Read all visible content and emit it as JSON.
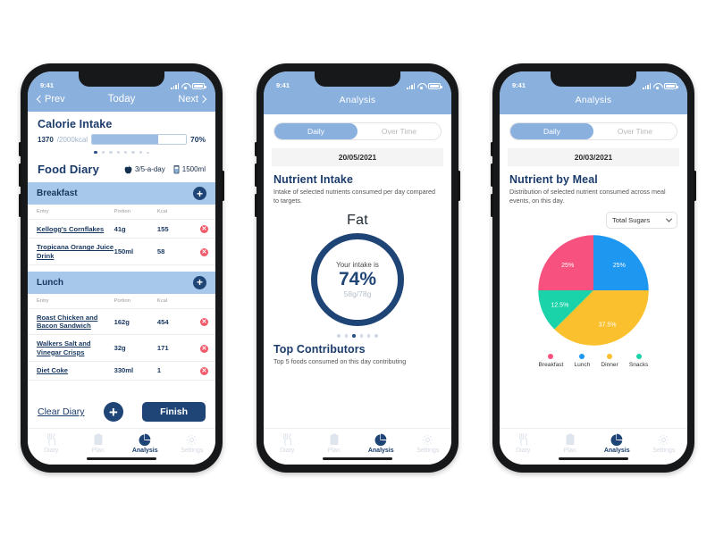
{
  "statusbar": {
    "time": "9:41"
  },
  "phone1": {
    "nav": {
      "prev": "Prev",
      "title": "Today",
      "next": "Next"
    },
    "calorie": {
      "title": "Calorie Intake",
      "current": "1370",
      "total": "/2000kcal",
      "percent_label": "70%",
      "percent_value": 70,
      "dots_total": 8,
      "dots_active": 1
    },
    "food_diary": {
      "title": "Food Diary",
      "five_a_day": "3/5-a-day",
      "water": "1500ml",
      "columns": [
        "Entry",
        "Portion",
        "Kcal"
      ],
      "meals": [
        {
          "name": "Breakfast",
          "rows": [
            {
              "entry": "Kellogg's Cornflakes",
              "portion": "41g",
              "kcal": "155"
            },
            {
              "entry": "Tropicana Orange Juice Drink",
              "portion": "150ml",
              "kcal": "58"
            }
          ]
        },
        {
          "name": "Lunch",
          "rows": [
            {
              "entry": "Roast Chicken and Bacon Sandwich",
              "portion": "162g",
              "kcal": "454"
            },
            {
              "entry": "Walkers Salt and Vinegar Crisps",
              "portion": "32g",
              "kcal": "171"
            },
            {
              "entry": "Diet Coke",
              "portion": "330ml",
              "kcal": "1"
            }
          ]
        }
      ]
    },
    "actions": {
      "clear": "Clear Diary",
      "add": "+",
      "finish": "Finish"
    }
  },
  "phone2": {
    "nav": {
      "title": "Analysis"
    },
    "segments": [
      "Daily",
      "Over Time"
    ],
    "segment_active": "Daily",
    "date": "20/05/2021",
    "section": {
      "title": "Nutrient Intake",
      "subtitle": "Intake of selected nutrients consumed per day compared to targets."
    },
    "nutrient": "Fat",
    "donut": {
      "caption": "Your intake is",
      "percent": "74%",
      "amounts": "58g/78g",
      "dots_total": 6,
      "dots_active": 3
    },
    "top_contributors": {
      "title": "Top Contributors",
      "subtitle": "Top 5 foods consumed on this day contributing"
    }
  },
  "phone3": {
    "nav": {
      "title": "Analysis"
    },
    "segments": [
      "Daily",
      "Over Time"
    ],
    "segment_active": "Daily",
    "date": "20/03/2021",
    "section": {
      "title": "Nutrient by Meal",
      "subtitle": "Distribution of selected nutrient consumed across meal events, on this day."
    },
    "dropdown": {
      "value": "Total Sugars",
      "icon": "chevron-down-icon"
    }
  },
  "chart_data": {
    "type": "pie",
    "title": "Nutrient by Meal",
    "nutrient": "Total Sugars",
    "categories": [
      "Breakfast",
      "Lunch",
      "Dinner",
      "Snacks"
    ],
    "values": [
      25,
      25,
      37.5,
      12.5
    ],
    "labels": [
      "25%",
      "25%",
      "37.5%",
      "12.5%"
    ],
    "colors": [
      "#f7527f",
      "#1d97f0",
      "#fbc02d",
      "#1ad3a8"
    ],
    "legend_position": "bottom",
    "start_angle_deg": 0
  },
  "tabbar": {
    "items": [
      {
        "label": "Diary",
        "icon": "cutlery-icon",
        "active": false
      },
      {
        "label": "Plan",
        "icon": "clipboard-icon",
        "active": false
      },
      {
        "label": "Analysis",
        "icon": "pie-chart-icon",
        "active": true
      },
      {
        "label": "Settings",
        "icon": "gear-icon",
        "active": false
      }
    ]
  },
  "colors": {
    "header_blue": "#8ab0de",
    "meal_blue": "#a7c8ea",
    "navy": "#1f4577",
    "delete_red": "#f05a6a"
  }
}
